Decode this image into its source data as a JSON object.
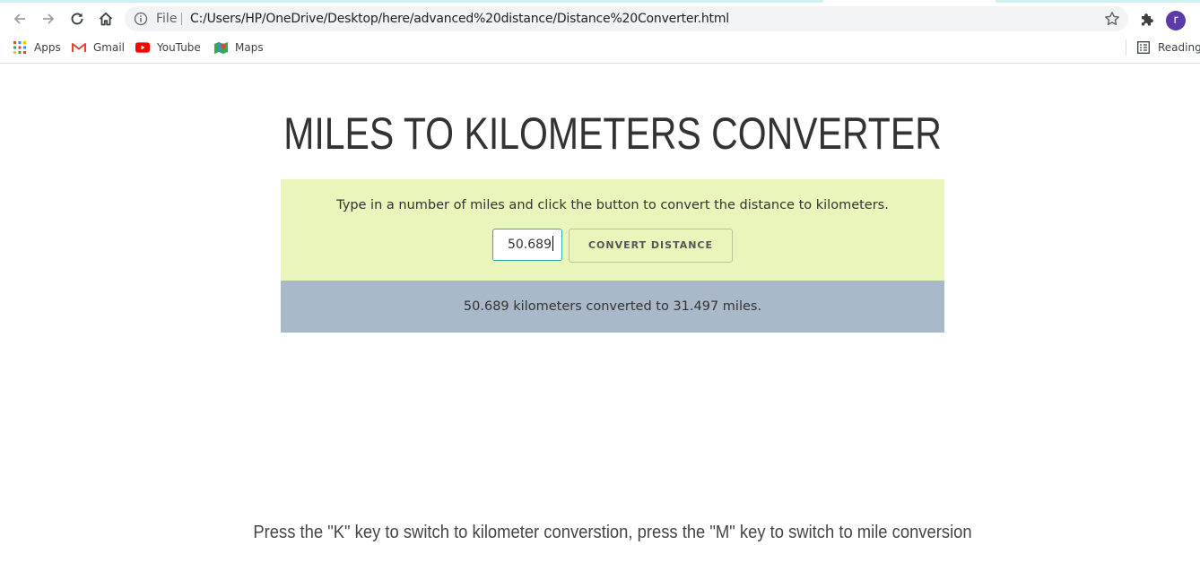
{
  "browser": {
    "address_scheme": "File",
    "url": "C:/Users/HP/OneDrive/Desktop/here/advanced%20distance/Distance%20Converter.html",
    "profile_initial": "r",
    "bookmarks": [
      {
        "label": "Apps",
        "icon": "apps-grid-icon"
      },
      {
        "label": "Gmail",
        "icon": "gmail-icon"
      },
      {
        "label": "YouTube",
        "icon": "youtube-icon"
      },
      {
        "label": "Maps",
        "icon": "maps-icon"
      }
    ],
    "reading_list_label": "Reading l"
  },
  "page": {
    "title": "MILES TO KILOMETERS CONVERTER",
    "instructions": "Type in a number of miles and click the button to convert the distance to kilometers.",
    "input_value": "50.689",
    "button_label": "CONVERT DISTANCE",
    "result": "50.689 kilometers converted to 31.497 miles.",
    "footer_hint": "Press the \"K\" key to switch to kilometer converstion, press the \"M\" key to switch to mile conversion"
  },
  "colors": {
    "converter_panel": "#e9f5bb",
    "result_panel": "#a9b9c9",
    "input_border": "#28b0a8",
    "avatar": "#5c3aa8"
  }
}
